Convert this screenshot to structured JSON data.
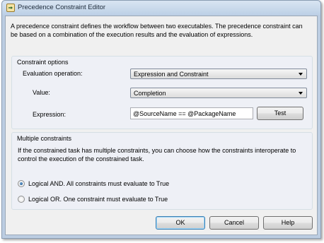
{
  "window": {
    "title": "Precedence Constraint Editor"
  },
  "description": "A precedence constraint defines the workflow between two executables. The precedence constraint can be based on a combination of the execution results and the evaluation of expressions.",
  "constraint_options": {
    "group_label": "Constraint options",
    "evaluation_operation": {
      "label": "Evaluation operation:",
      "value": "Expression and Constraint"
    },
    "value": {
      "label": "Value:",
      "value": "Completion"
    },
    "expression": {
      "label": "Expression:",
      "value": "@SourceName == @PackageName"
    },
    "test_button": "Test"
  },
  "multiple_constraints": {
    "group_label": "Multiple constraints",
    "description": "If the constrained task has multiple constraints, you can choose how the constraints interoperate to control the execution of the constrained task.",
    "options": [
      {
        "label": "Logical AND. All constraints must evaluate to True",
        "selected": true
      },
      {
        "label": "Logical OR. One constraint must evaluate to True",
        "selected": false
      }
    ]
  },
  "buttons": {
    "ok": "OK",
    "cancel": "Cancel",
    "help": "Help"
  },
  "colors": {
    "accent": "#184e86",
    "titlebar": "#bdd0e6",
    "group_bg": "#eef0f6"
  }
}
